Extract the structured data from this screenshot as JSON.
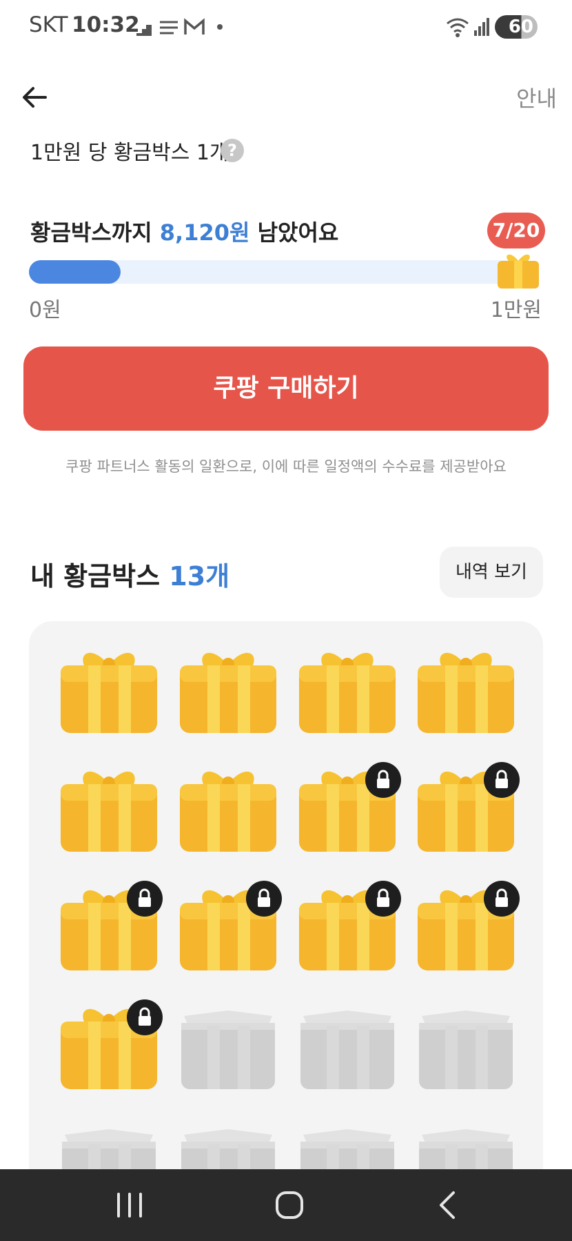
{
  "status_bar": {
    "carrier": "SKT",
    "time": "10:32",
    "battery": "60",
    "icons": [
      "stairs-icon",
      "cashfeed-icon",
      "gmail-icon",
      "dot-icon",
      "wifi-icon",
      "signal-icon",
      "battery-icon"
    ]
  },
  "header": {
    "back_icon": "arrow-left-icon",
    "guide_label": "안내"
  },
  "info": {
    "text": "1만원 당 황금박스 1개",
    "help_glyph": "?"
  },
  "progress": {
    "prefix": "황금박스까지 ",
    "amount": "8,120원",
    "suffix": " 남았어요",
    "count_badge": "7/20",
    "fraction": 0.188,
    "min_label": "0원",
    "max_label": "1만원",
    "accent_color": "#4b86e0",
    "track_color": "#eaf2fd"
  },
  "buy_button": {
    "label": "쿠팡 구매하기",
    "color": "#e5554a"
  },
  "disclaimer": "쿠팡 파트너스 활동의 일환으로, 이에 따른 일정액의 수수료를 제공받아요",
  "my_boxes": {
    "title_prefix": "내 황금박스 ",
    "count": "13개",
    "history_label": "내역 보기",
    "boxes": [
      {
        "state": "gold",
        "locked": false
      },
      {
        "state": "gold",
        "locked": false
      },
      {
        "state": "gold",
        "locked": false
      },
      {
        "state": "gold",
        "locked": false
      },
      {
        "state": "gold",
        "locked": false
      },
      {
        "state": "gold",
        "locked": false
      },
      {
        "state": "gold",
        "locked": true
      },
      {
        "state": "gold",
        "locked": true
      },
      {
        "state": "gold",
        "locked": true
      },
      {
        "state": "gold",
        "locked": true
      },
      {
        "state": "gold",
        "locked": true
      },
      {
        "state": "gold",
        "locked": true
      },
      {
        "state": "gold",
        "locked": true
      },
      {
        "state": "empty",
        "locked": false
      },
      {
        "state": "empty",
        "locked": false
      },
      {
        "state": "empty",
        "locked": false
      },
      {
        "state": "empty",
        "locked": false
      },
      {
        "state": "empty",
        "locked": false
      },
      {
        "state": "empty",
        "locked": false
      },
      {
        "state": "empty",
        "locked": false
      }
    ]
  },
  "nav_bar": {
    "buttons": [
      "recent-apps-icon",
      "home-icon",
      "back-icon"
    ]
  }
}
